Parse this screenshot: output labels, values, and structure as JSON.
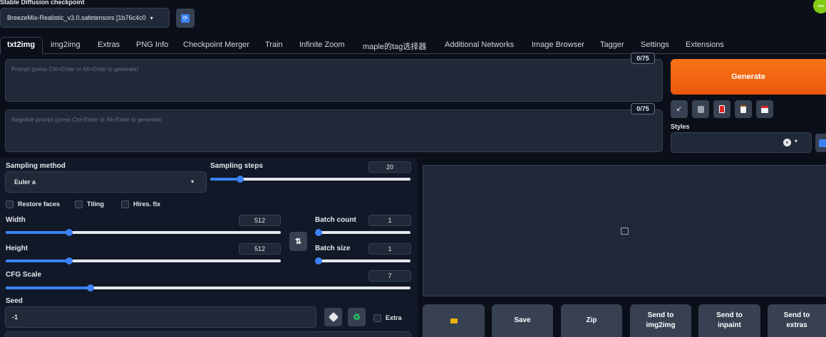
{
  "checkpoint": {
    "label": "Stable Diffusion checkpoint",
    "value": "BreezeMix-Realistic_v3.0.safetensors [1b76c4c0"
  },
  "tabs": [
    {
      "label": "txt2img",
      "active": true
    },
    {
      "label": "img2img"
    },
    {
      "label": "Extras"
    },
    {
      "label": "PNG Info"
    },
    {
      "label": "Checkpoint Merger"
    },
    {
      "label": "Train"
    },
    {
      "label": "Infinite Zoom"
    },
    {
      "label": "maple的tag选择器"
    },
    {
      "label": "Additional Networks"
    },
    {
      "label": "Image Browser"
    },
    {
      "label": "Tagger"
    },
    {
      "label": "Settings"
    },
    {
      "label": "Extensions"
    }
  ],
  "prompt": {
    "placeholder": "Prompt (press Ctrl+Enter or Alt+Enter to generate)",
    "counter": "0/75"
  },
  "negative_prompt": {
    "placeholder": "Negative prompt (press Ctrl+Enter or Alt+Enter to generate)",
    "counter": "0/75"
  },
  "generate_label": "Generate",
  "styles_label": "Styles",
  "sampling_method": {
    "label": "Sampling method",
    "value": "Euler a"
  },
  "sampling_steps": {
    "label": "Sampling steps",
    "value": "20",
    "fraction": 0.15
  },
  "checkboxes": {
    "restore_faces": "Restore faces",
    "tiling": "Tiling",
    "hires_fix": "Hires. fix"
  },
  "width": {
    "label": "Width",
    "value": "512",
    "fraction": 0.23
  },
  "height": {
    "label": "Height",
    "value": "512",
    "fraction": 0.23
  },
  "batch_count": {
    "label": "Batch count",
    "value": "1",
    "fraction": 0.0
  },
  "batch_size": {
    "label": "Batch size",
    "value": "1",
    "fraction": 0.0
  },
  "cfg_scale": {
    "label": "CFG Scale",
    "value": "7",
    "fraction": 0.21
  },
  "seed": {
    "label": "Seed",
    "value": "-1",
    "extra_label": "Extra"
  },
  "swap_icon_text": "⇅",
  "gallery_buttons": {
    "save": "Save",
    "zip": "Zip",
    "send_img2img_1": "Send to",
    "send_img2img_2": "img2img",
    "send_inpaint_1": "Send to",
    "send_inpaint_2": "inpaint",
    "send_extras_1": "Send to",
    "send_extras_2": "extras"
  },
  "colors": {
    "accent": "#3b82f6",
    "generate": "#f97316",
    "background": "#0b0f19"
  }
}
